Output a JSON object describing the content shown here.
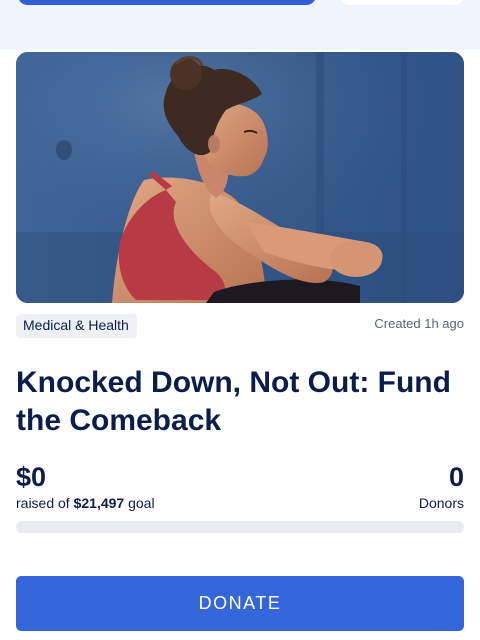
{
  "campaign": {
    "category": "Medical & Health",
    "created": "Created 1h ago",
    "title": "Knocked Down, Not Out: Fund the Comeback",
    "hero_image": "athlete-sitting-photo"
  },
  "funding": {
    "amount_raised": "$0",
    "raised_prefix": "raised of ",
    "goal": "$21,497",
    "goal_suffix": " goal",
    "progress_fraction": 0,
    "donor_count": "0",
    "donor_label": "Donors"
  },
  "actions": {
    "donate_label": "DONATE"
  },
  "colors": {
    "accent": "#3466d9",
    "title_text": "#0b1e4b",
    "badge_bg": "#eef0f3",
    "progress_track": "#eaebee",
    "top_band": "#eef5fd"
  }
}
